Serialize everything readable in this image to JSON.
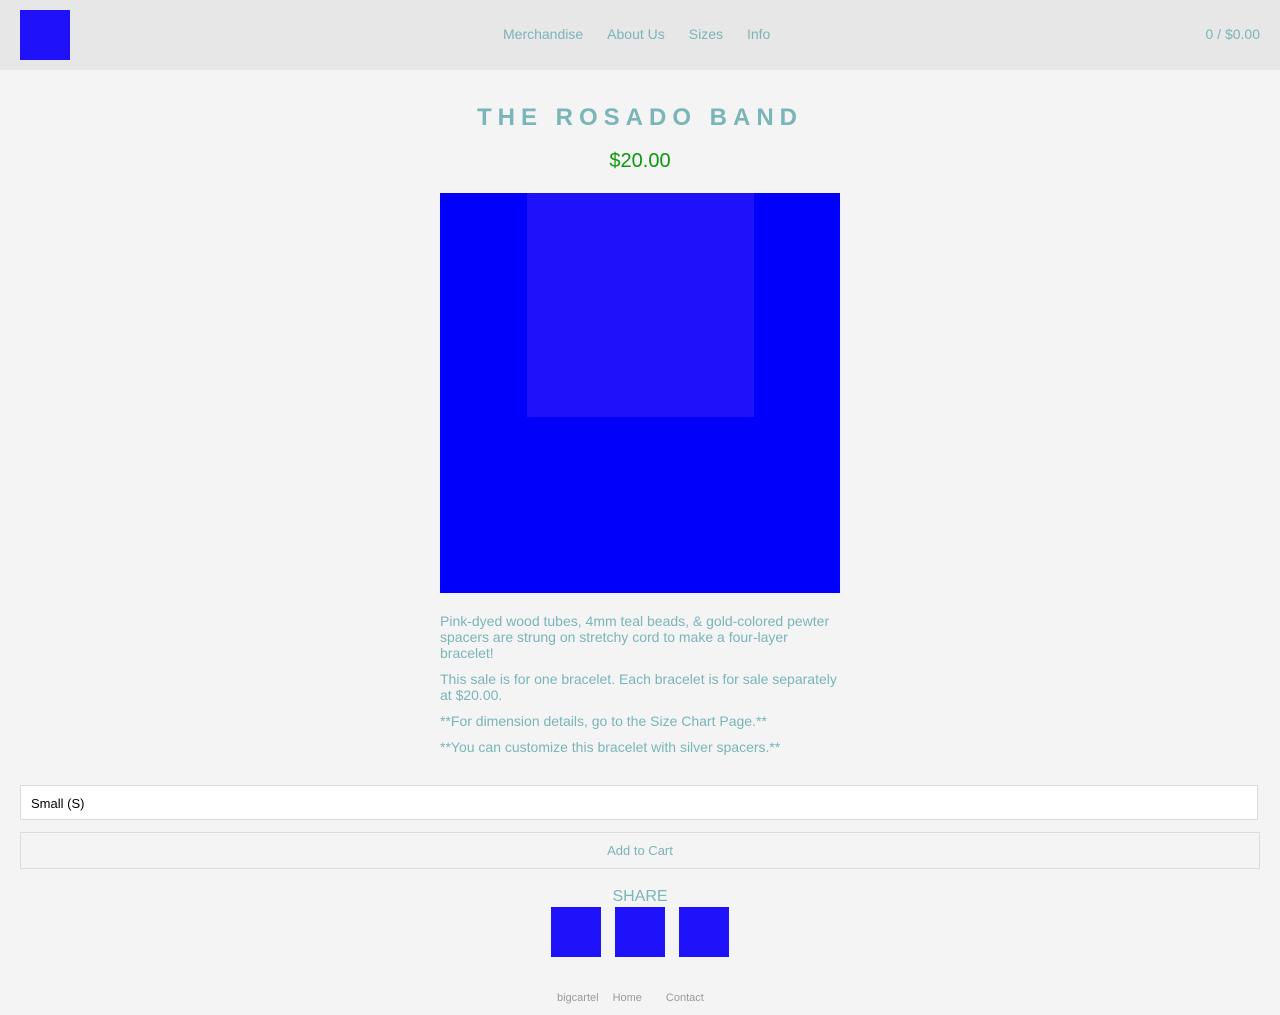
{
  "header": {
    "nav": [
      "Merchandise",
      "About Us",
      "Sizes",
      "Info"
    ],
    "cart_summary": "0 / $0.00"
  },
  "product": {
    "title": "THE ROSADO BAND",
    "price": "$20.00",
    "description": [
      "Pink-dyed wood tubes, 4mm teal beads, & gold-colored pewter spacers are strung on stretchy cord to make a four-layer bracelet!",
      "This sale is for one bracelet. Each bracelet is for sale separately at $20.00.",
      "**For dimension details, go to the Size Chart Page.**",
      "**You can customize this bracelet with silver spacers.**"
    ],
    "selected_option": "Small (S)",
    "add_to_cart_label": "Add to Cart"
  },
  "share": {
    "label": "SHARE"
  },
  "footer": {
    "links": [
      "bigcartel",
      "Home",
      "Contact"
    ]
  },
  "colors": {
    "accent": "#7ab5b8",
    "price": "#0c9a0c",
    "placeholder_image": "#1f12fa"
  }
}
